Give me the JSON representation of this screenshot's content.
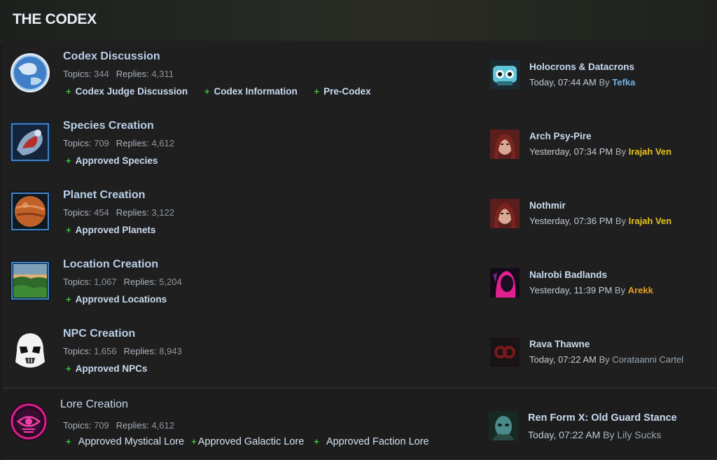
{
  "header": {
    "title": "THE CODEX"
  },
  "labels": {
    "topics": "Topics:",
    "replies": "Replies:",
    "by": "By"
  },
  "forums": [
    {
      "name": "Codex Discussion",
      "topics": "344",
      "replies": "4,311",
      "subforums": [
        "Codex Judge Discussion",
        "Codex Information",
        "Pre-Codex"
      ],
      "last_post": {
        "topic": "Holocrons & Datacrons",
        "time": "Today, 07:44 AM",
        "user": "Tefka",
        "user_color": "#6fb3e8"
      }
    },
    {
      "name": "Species Creation",
      "topics": "709",
      "replies": "4,612",
      "subforums": [
        "Approved Species"
      ],
      "last_post": {
        "topic": "Arch Psy-Pire",
        "time": "Yesterday, 07:34 PM",
        "user": "Irajah Ven",
        "user_color": "#e6c21a"
      }
    },
    {
      "name": "Planet Creation",
      "topics": "454",
      "replies": "3,122",
      "subforums": [
        "Approved Planets"
      ],
      "last_post": {
        "topic": "Nothmir",
        "time": "Yesterday, 07:36 PM",
        "user": "Irajah Ven",
        "user_color": "#e6c21a"
      }
    },
    {
      "name": "Location Creation",
      "topics": "1,067",
      "replies": "5,204",
      "subforums": [
        "Approved Locations"
      ],
      "last_post": {
        "topic": "Nalrobi Badlands",
        "time": "Yesterday, 11:39 PM",
        "user": "Arekk",
        "user_color": "#e8a020"
      }
    },
    {
      "name": "NPC Creation",
      "topics": "1,656",
      "replies": "8,943",
      "subforums": [
        "Approved NPCs"
      ],
      "last_post": {
        "topic": "Rava Thawne",
        "time": "Today, 07:22 AM",
        "user": "Corataanni Cartel",
        "user_color": "#9aa7b2"
      }
    },
    {
      "name": "Lore Creation",
      "topics": "709",
      "replies": "4,612",
      "subforums": [
        "Approved Mystical Lore",
        "Approved Galactic Lore",
        "Approved Faction Lore"
      ],
      "last_post": {
        "topic": "Ren Form X: Old Guard Stance",
        "time": "Today, 07:22 AM",
        "user": "Lily Sucks",
        "user_color": "#9aa7b2"
      }
    }
  ],
  "icons": {
    "forums": [
      "globe-icon",
      "species-icon",
      "planet-icon",
      "landscape-icon",
      "stormtrooper-helmet-icon",
      "lore-eye-icon"
    ],
    "avatars": [
      "robot-avatar",
      "woman-avatar",
      "woman-avatar",
      "hooded-figure-avatar",
      "cartel-logo-avatar",
      "alien-avatar"
    ]
  }
}
